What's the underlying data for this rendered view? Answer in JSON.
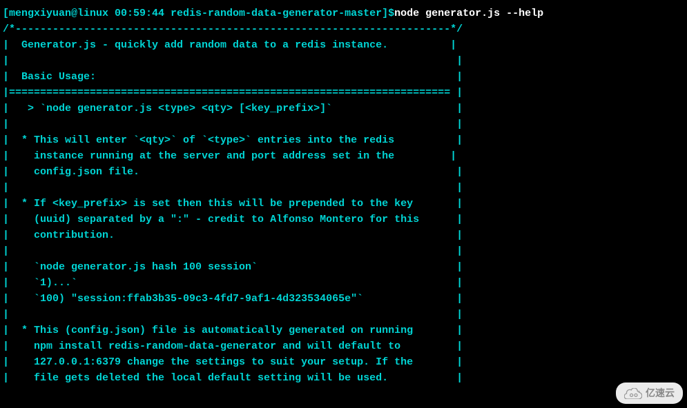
{
  "terminal": {
    "prompt": "[mengxiyuan@linux 00:59:44 redis-random-data-generator-master]$",
    "command": "node generator.js --help",
    "output": {
      "line01": "",
      "line02": "/*----------------------------------------------------------------------*/",
      "line03": "|  Generator.js - quickly add random data to a redis instance.          |",
      "line04": "|                                                                        |",
      "line05": "|  Basic Usage:                                                          |",
      "line06": "|======================================================================= |",
      "line07": "|   > `node generator.js <type> <qty> [<key_prefix>]`                    |",
      "line08": "|                                                                        |",
      "line09": "|  * This will enter `<qty>` of `<type>` entries into the redis          |",
      "line10": "|    instance running at the server and port address set in the         |",
      "line11": "|    config.json file.                                                   |",
      "line12": "|                                                                        |",
      "line13": "|  * If <key_prefix> is set then this will be prepended to the key       |",
      "line14": "|    (uuid) separated by a \":\" - credit to Alfonso Montero for this      |",
      "line15": "|    contribution.                                                       |",
      "line16": "|                                                                        |",
      "line17": "|    `node generator.js hash 100 session`                                |",
      "line18": "|    `1)...`                                                             |",
      "line19": "|    `100) \"session:ffab3b35-09c3-4fd7-9af1-4d323534065e\"`               |",
      "line20": "|                                                                        |",
      "line21": "|  * This (config.json) file is automatically generated on running       |",
      "line22": "|    npm install redis-random-data-generator and will default to         |",
      "line23": "|    127.0.0.1:6379 change the settings to suit your setup. If the       |",
      "line24": "|    file gets deleted the local default setting will be used.           |"
    }
  },
  "watermark": {
    "text": "亿速云"
  }
}
